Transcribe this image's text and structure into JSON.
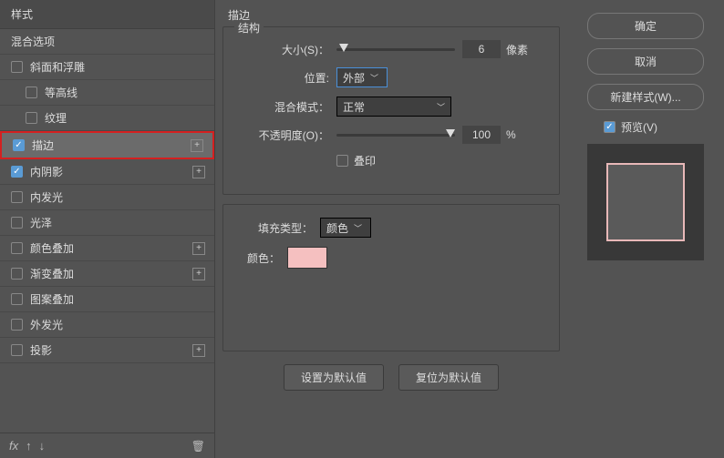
{
  "left": {
    "header": "样式",
    "blend_options": "混合选项",
    "items": [
      {
        "label": "斜面和浮雕",
        "checked": false,
        "hasAdd": false
      },
      {
        "label": "等高线",
        "checked": false,
        "sub": true
      },
      {
        "label": "纹理",
        "checked": false,
        "sub": true
      },
      {
        "label": "描边",
        "checked": true,
        "selected": true,
        "hasAdd": true,
        "red": true
      },
      {
        "label": "内阴影",
        "checked": true,
        "hasAdd": true
      },
      {
        "label": "内发光",
        "checked": false
      },
      {
        "label": "光泽",
        "checked": false
      },
      {
        "label": "颜色叠加",
        "checked": false,
        "hasAdd": true
      },
      {
        "label": "渐变叠加",
        "checked": false,
        "hasAdd": true
      },
      {
        "label": "图案叠加",
        "checked": false
      },
      {
        "label": "外发光",
        "checked": false
      },
      {
        "label": "投影",
        "checked": false,
        "hasAdd": true
      }
    ],
    "fx_label": "fx"
  },
  "middle": {
    "title": "描边",
    "structure_legend": "结构",
    "size_label": "大小(S)：",
    "size_value": "6",
    "size_unit": "像素",
    "position_label": "位置:",
    "position_value": "外部",
    "blend_label": "混合模式：",
    "blend_value": "正常",
    "opacity_label": "不透明度(O)：",
    "opacity_value": "100",
    "opacity_unit": "%",
    "overprint_label": "叠印",
    "filltype_label": "填充类型：",
    "filltype_value": "颜色",
    "color_label": "颜色：",
    "btn_default": "设置为默认值",
    "btn_reset": "复位为默认值"
  },
  "right": {
    "ok": "确定",
    "cancel": "取消",
    "new_style": "新建样式(W)...",
    "preview": "预览(V)"
  }
}
